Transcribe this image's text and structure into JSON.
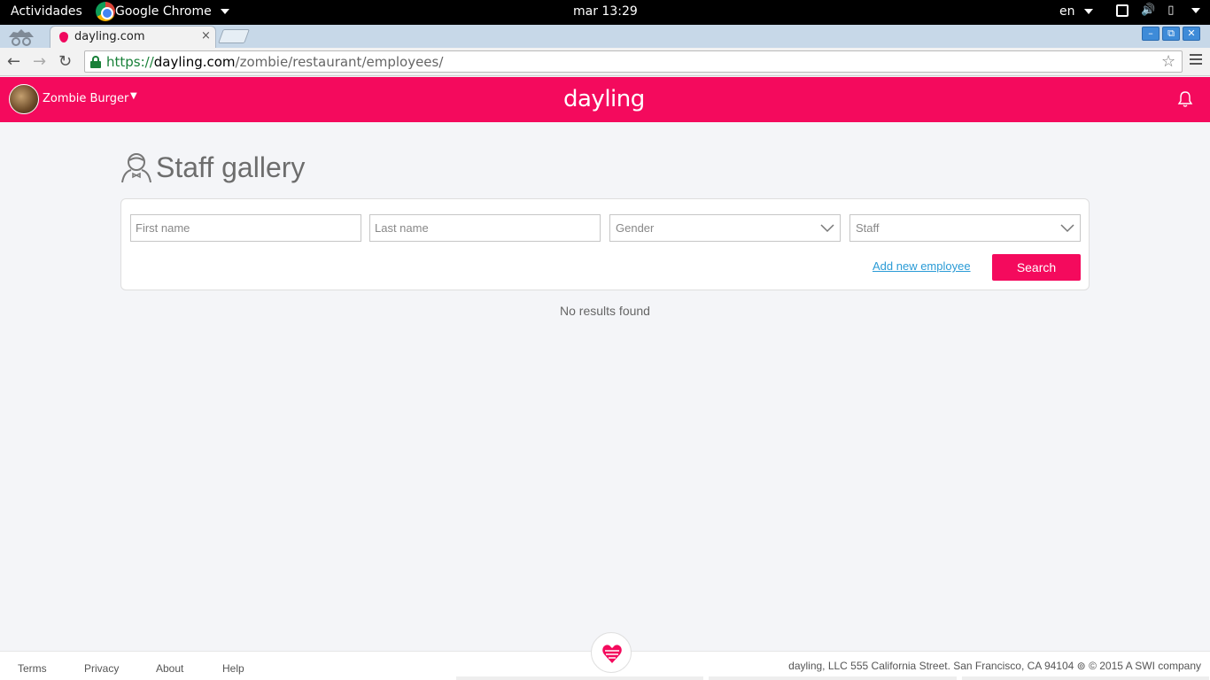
{
  "os_bar": {
    "activities": "Actividades",
    "app_name": "Google Chrome",
    "clock": "mar 13:29",
    "language": "en"
  },
  "browser": {
    "tab_title": "dayling.com",
    "tab_close": "×",
    "url_scheme": "https://",
    "url_host": "dayling.com",
    "url_path": "/zombie/restaurant/employees/",
    "window_buttons": [
      "–",
      "⧉",
      "✕"
    ]
  },
  "header": {
    "account_name": "Zombie Burger",
    "account_caret": "▼",
    "logo": "dayling",
    "brand_color": "#f40a5d"
  },
  "page": {
    "title": "Staff gallery",
    "title_icon": "staff-person-icon",
    "first_name_placeholder": "First name",
    "last_name_placeholder": "Last name",
    "gender_select": "Gender",
    "role_select": "Staff",
    "add_employee_link": "Add new employee",
    "search_button": "Search",
    "no_results": "No results found"
  },
  "footer": {
    "links": [
      "Terms",
      "Privacy",
      "About",
      "Help"
    ],
    "company_info": "dayling, LLC 555 California Street. San Francisco, CA 94104",
    "copyright": "© 2015 A SWI company"
  }
}
